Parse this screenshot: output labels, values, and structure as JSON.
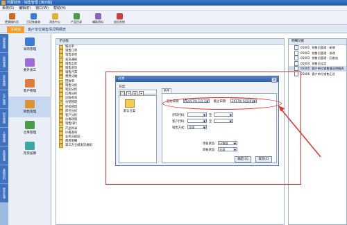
{
  "window": {
    "title": "鸿蒙财务 · 销售管理 [演示版]"
  },
  "menu": [
    "系统(S)",
    "编辑(E)",
    "窗口(W)",
    "帮助(H)"
  ],
  "toolbar": [
    {
      "label": "更换操作员",
      "icon": "user-switch-icon",
      "color": "#d2691e"
    },
    {
      "label": "日记帐查询",
      "icon": "ledger-icon",
      "color": "#3a7bd5"
    },
    {
      "label": "消息中心",
      "icon": "mail-icon",
      "color": "#e0b03a"
    },
    {
      "label": "产品目录",
      "icon": "catalog-icon",
      "color": "#4a9b4a"
    },
    {
      "label": "辅助资料",
      "icon": "tools-icon",
      "color": "#8a62c9"
    },
    {
      "label": "退出系统",
      "icon": "exit-icon",
      "color": "#c94040"
    }
  ],
  "tabs": {
    "home": "主控台",
    "breadcrumb": "客户单位销售情况明细表"
  },
  "vtabs": [
    "销售管理",
    "采购管理",
    "库存管理",
    "生产管理",
    "财务管理",
    "人事管理",
    "系统管理",
    "基础资料",
    "账务处理"
  ],
  "modules": [
    {
      "label": "采购管理",
      "icon": "purchase-icon",
      "color": "#3a7bd5"
    },
    {
      "label": "委外加工",
      "icon": "outsource-icon",
      "color": "#9c6bd4"
    },
    {
      "label": "客户管理",
      "icon": "customer-icon",
      "color": "#e07b39"
    },
    {
      "label": "销售管理",
      "icon": "sales-icon",
      "color": "#d9932f",
      "selected": true
    },
    {
      "label": "仓库管理",
      "icon": "warehouse-icon",
      "color": "#4a9b4a"
    },
    {
      "label": "存货核算",
      "icon": "inventory-icon",
      "color": "#3aa6a6"
    }
  ],
  "subpanel": {
    "title": "子功能",
    "items": [
      "报价单",
      "销售订单",
      "销售退单",
      "发货通知",
      "销售出库",
      "销售退货",
      "销售开票",
      "费用分摊",
      "回款单",
      "销售分析",
      "利润分析",
      "信用分析",
      "应收查询",
      "分销管理",
      "折扣管理",
      "库存分析",
      "客户分析",
      "价格政策",
      "销售排行",
      "产品目录",
      "价格查询",
      "业务员提成",
      "费用明细",
      "第三方仓储发货通知"
    ]
  },
  "rightpanel": {
    "title": "明细功能",
    "items": [
      {
        "code": "05001",
        "label": "销售员管理 - 新增"
      },
      {
        "code": "05002",
        "label": "销售员管理 - 修改"
      },
      {
        "code": "05003",
        "label": "销售员管理 - 回收站"
      },
      {
        "code": "05004",
        "label": "销售员设定"
      },
      {
        "code": "05005",
        "label": "客户单位销售情况明细表"
      },
      {
        "code": "05006",
        "label": "客户单位销售汇总"
      }
    ]
  },
  "dialog": {
    "title": "过滤",
    "scheme_label": "方案:",
    "scheme_tools": [
      "□",
      "✕",
      "▤",
      "★"
    ],
    "scheme_item": "默认方案",
    "tab": "条件",
    "start_date_label": "起始日期:",
    "start_date": "2017年 1月 1日",
    "end_date_label": "截止日期:",
    "end_date": "2017年 6月30日",
    "product_code_label": "存料代码:",
    "customer_code_label": "客户代码:",
    "sales_mode_label": "销售方式:",
    "sales_mode": "全部",
    "to_label": "至",
    "audit_status_label": "审核状态:",
    "audit_status": "已审核",
    "transfer_status_label": "转帐状态:",
    "transfer_status": "全部",
    "ok": "确定(O)",
    "cancel": "取消(C)"
  }
}
